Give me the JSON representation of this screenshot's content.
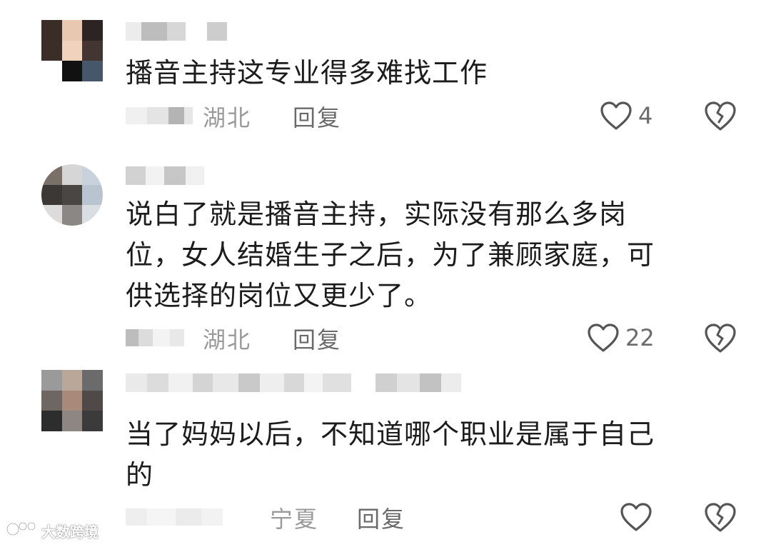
{
  "comments": [
    {
      "text": "播音主持这专业得多难找工作",
      "location": "湖北",
      "reply_label": "回复",
      "like_count": "4"
    },
    {
      "text": "说白了就是播音主持，实际没有那么多岗\n位，女人结婚生子之后，为了兼顾家庭，可\n供选择的岗位又更少了。",
      "location": "湖北",
      "reply_label": "回复",
      "like_count": "22"
    },
    {
      "text": "当了妈妈以后，不知道哪个职业是属于自己\n的",
      "location": "宁夏",
      "reply_label": "回复",
      "like_count": ""
    }
  ],
  "icons": {
    "like": "heart-outline-icon",
    "dislike": "broken-heart-icon",
    "watermark": "watermark-logo-icon"
  },
  "watermark": {
    "text": "大数跨境"
  },
  "colors": {
    "text": "#1c1c1c",
    "meta": "#9a9a9a",
    "reply": "#6a6a6a",
    "icon": "#555555"
  }
}
